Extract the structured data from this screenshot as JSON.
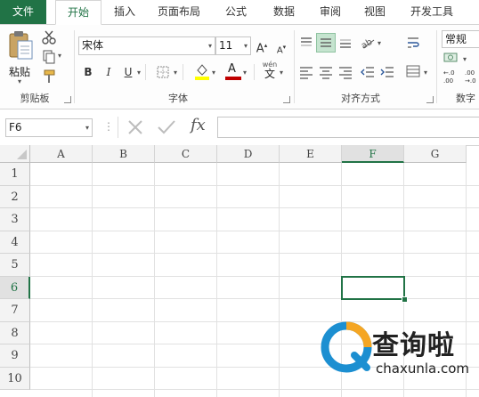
{
  "tabs": [
    {
      "label": "文件"
    },
    {
      "label": "开始"
    },
    {
      "label": "插入"
    },
    {
      "label": "页面布局"
    },
    {
      "label": "公式"
    },
    {
      "label": "数据"
    },
    {
      "label": "审阅"
    },
    {
      "label": "视图"
    },
    {
      "label": "开发工具"
    }
  ],
  "ribbon": {
    "clipboard": {
      "paste_label": "粘贴",
      "group_label": "剪贴板"
    },
    "font": {
      "font_name": "宋体",
      "font_size": "11",
      "bold": "B",
      "italic": "I",
      "underline": "U",
      "font_color_glyph": "A",
      "wen_glyph": "wén",
      "wen_char": "文",
      "grow": "A",
      "shrink": "A",
      "group_label": "字体",
      "fill_color": "#ffff00",
      "font_color": "#c00000"
    },
    "alignment": {
      "group_label": "对齐方式"
    },
    "number": {
      "format": "常规",
      "group_label": "数字"
    }
  },
  "formula_bar": {
    "name_box": "F6",
    "fx": "fx",
    "value": ""
  },
  "grid": {
    "columns": [
      "A",
      "B",
      "C",
      "D",
      "E",
      "F",
      "G"
    ],
    "rows": [
      "1",
      "2",
      "3",
      "4",
      "5",
      "6",
      "7",
      "8",
      "9",
      "10"
    ],
    "selected_column": "F",
    "selected_row": "6",
    "accent": "#217346"
  },
  "watermark": {
    "brand": "查询啦",
    "domain": "chaxunla.com"
  }
}
